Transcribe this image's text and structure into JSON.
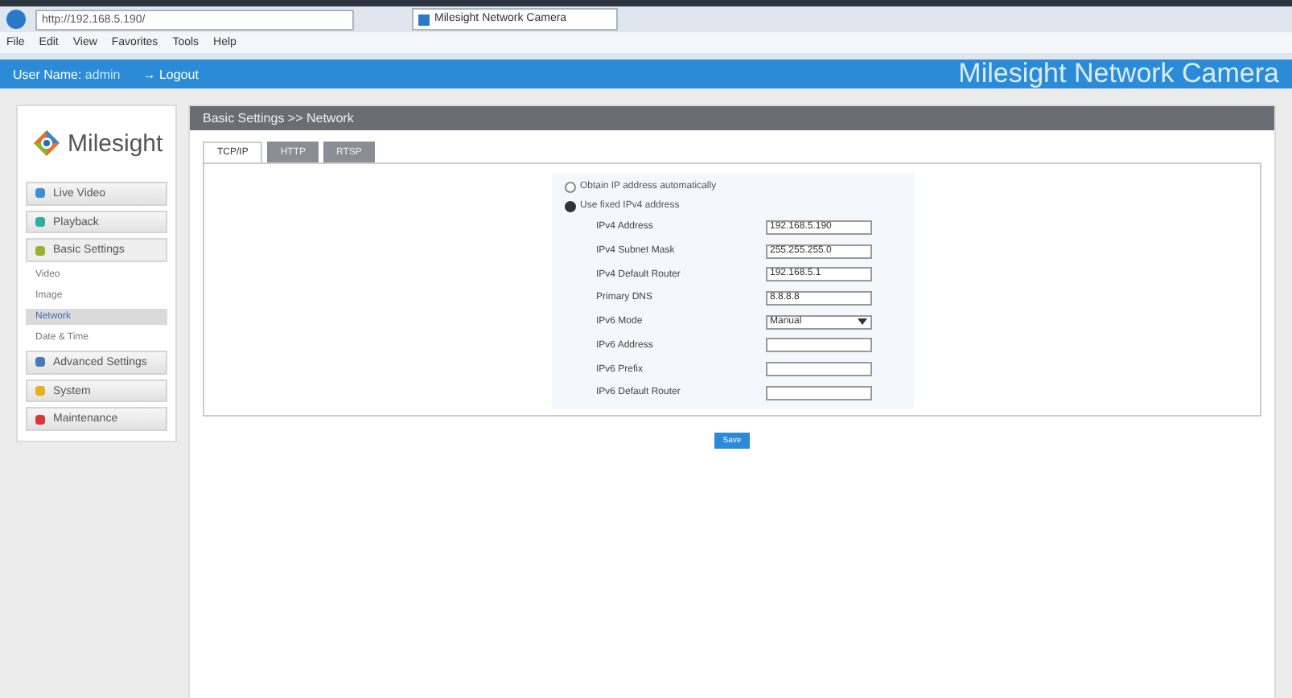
{
  "browser": {
    "address": "http://192.168.5.190/",
    "tab_title": "Milesight Network Camera",
    "menu": [
      "File",
      "Edit",
      "View",
      "Favorites",
      "Tools",
      "Help"
    ]
  },
  "header": {
    "user_label": "User Name:",
    "user": "admin",
    "logout": "→ Logout",
    "brand": "Milesight Network Camera"
  },
  "sidebar": {
    "logo": "Milesight",
    "items": [
      {
        "label": "Live Video",
        "color": "#3a8fd6",
        "selected": false
      },
      {
        "label": "Playback",
        "color": "#2ab0a0",
        "selected": false
      },
      {
        "label": "Basic Settings",
        "color": "#9ab030",
        "selected": true,
        "children": [
          {
            "label": "Video",
            "selected": false
          },
          {
            "label": "Image",
            "selected": false
          },
          {
            "label": "Network",
            "selected": true
          },
          {
            "label": "Date & Time",
            "selected": false
          }
        ]
      },
      {
        "label": "Advanced Settings",
        "color": "#4a78b8",
        "selected": false
      },
      {
        "label": "System",
        "color": "#e8b020",
        "selected": false
      },
      {
        "label": "Maintenance",
        "color": "#d83838",
        "selected": false
      }
    ]
  },
  "content": {
    "title": "Basic Settings >> Network",
    "tabs": [
      {
        "label": "TCP/IP",
        "selected": true
      },
      {
        "label": "HTTP",
        "selected": false
      },
      {
        "label": "RTSP",
        "selected": false
      }
    ],
    "options": [
      {
        "label": "Obtain IP address automatically",
        "selected": false
      },
      {
        "label": "Use fixed IPv4 address",
        "selected": true
      }
    ],
    "fields": [
      {
        "kind": "text",
        "label": "IPv4 Address",
        "value": "192.168.5.190"
      },
      {
        "kind": "text",
        "label": "IPv4 Subnet Mask",
        "value": "255.255.255.0"
      },
      {
        "kind": "text",
        "label": "IPv4 Default Router",
        "value": "192.168.5.1"
      },
      {
        "kind": "text",
        "label": "Primary DNS",
        "value": "8.8.8.8"
      },
      {
        "kind": "select",
        "label": "IPv6 Mode",
        "value": "Manual"
      },
      {
        "kind": "text",
        "label": "IPv6 Address"
      },
      {
        "kind": "text",
        "label": "IPv6 Prefix"
      },
      {
        "kind": "text",
        "label": "IPv6 Default Router"
      }
    ],
    "save": "Save"
  }
}
